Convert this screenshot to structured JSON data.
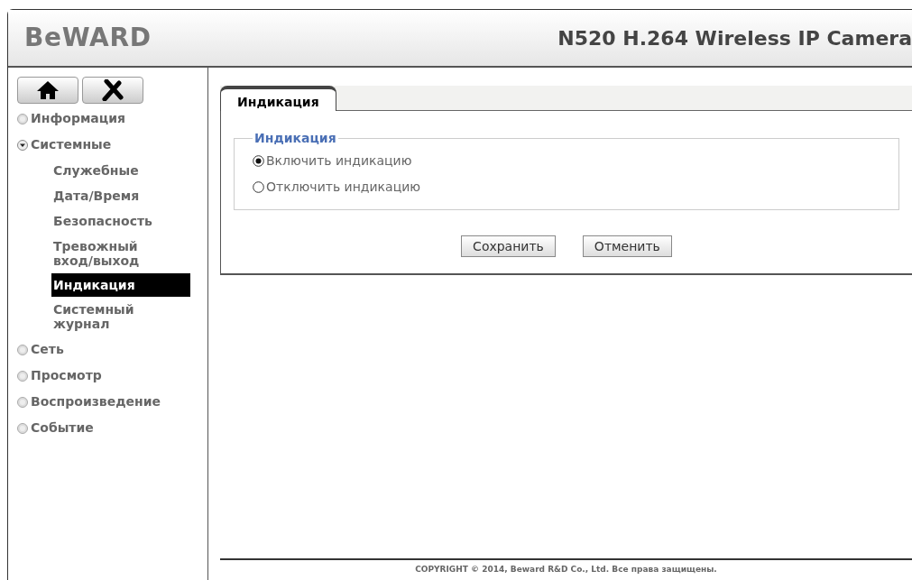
{
  "header": {
    "logo": "BeWARD",
    "title": "N520 H.264 Wireless IP Camera"
  },
  "sidebar": {
    "categories": [
      {
        "label": "Информация",
        "expanded": false
      },
      {
        "label": "Системные",
        "expanded": true,
        "children": [
          {
            "label": "Служебные",
            "selected": false
          },
          {
            "label": "Дата/Время",
            "selected": false
          },
          {
            "label": "Безопасность",
            "selected": false
          },
          {
            "label": "Тревожный вход/выход",
            "selected": false
          },
          {
            "label": "Индикация",
            "selected": true
          },
          {
            "label": "Системный журнал",
            "selected": false
          }
        ]
      },
      {
        "label": "Сеть",
        "expanded": false
      },
      {
        "label": "Просмотр",
        "expanded": false
      },
      {
        "label": "Воспроизведение",
        "expanded": false
      },
      {
        "label": "Событие",
        "expanded": false
      }
    ]
  },
  "tabs": [
    {
      "label": "Индикация",
      "selected": true
    }
  ],
  "fieldset": {
    "legend": "Индикация",
    "options": [
      {
        "label": "Включить индикацию",
        "selected": true
      },
      {
        "label": "Отключить индикацию",
        "selected": false
      }
    ]
  },
  "buttons": [
    "Сохранить",
    "Отменить"
  ],
  "footer": "COPYRIGHT © 2014, Beward R&D Co., Ltd. Все права защищены."
}
